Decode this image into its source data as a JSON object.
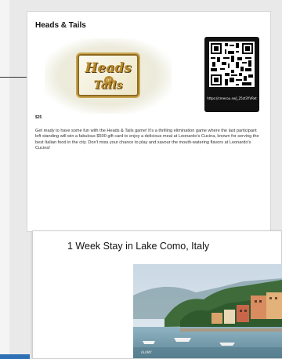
{
  "card1": {
    "title": "Heads & Tails",
    "logo": {
      "line1": "Heads",
      "or": "or",
      "line2": "Tails"
    },
    "qr_url": "https://cmecou.se/j_25zt3YVRet",
    "price": "$25",
    "description": "Get ready to have some fun with the Heads & Tails game! It's a thrilling elimination game where the last participant left standing will win a fabulous $500 gift card to enjoy a delicious meal at Leonardo's Cucina, known for serving the best Italian food in the city. Don't miss your chance to play and savour the mouth-watering flavors at Leonardo's Cucina!"
  },
  "card2": {
    "title": "1 Week Stay in Lake Como, Italy",
    "photo_credit": "ALAMY"
  },
  "colors": {
    "page_background": "#e9e9e9",
    "card_background": "#ffffff",
    "logo_gold": "#b8892a",
    "accent_blue": "#2f6fb3"
  }
}
